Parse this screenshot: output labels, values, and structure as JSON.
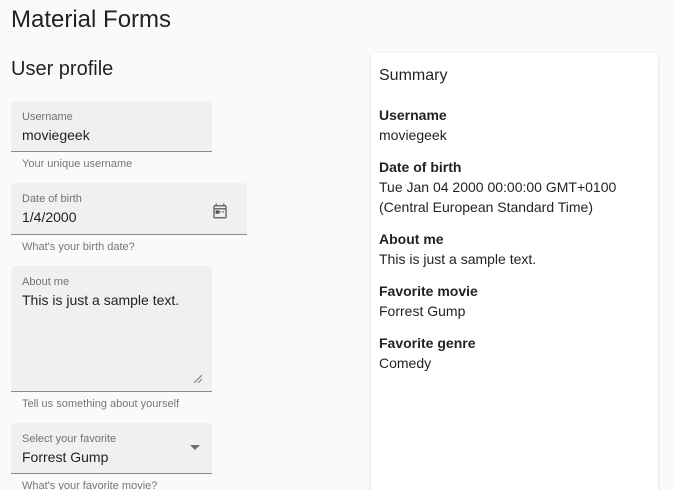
{
  "app": {
    "title": "Material Forms"
  },
  "form": {
    "title": "User profile",
    "username": {
      "label": "Username",
      "value": "moviegeek",
      "hint": "Your unique username"
    },
    "dob": {
      "label": "Date of birth",
      "value": "1/4/2000",
      "hint": "What's your birth date?",
      "icon": "calendar-icon"
    },
    "about": {
      "label": "About me",
      "value": "This is just a sample text.",
      "hint": "Tell us something about yourself"
    },
    "movie": {
      "label": "Select your favorite",
      "value": "Forrest Gump",
      "hint": "What's your favorite movie?",
      "icon": "chevron-down-icon"
    }
  },
  "summary": {
    "title": "Summary",
    "items": [
      {
        "key": "Username",
        "value": "moviegeek"
      },
      {
        "key": "Date of birth",
        "value": "Tue Jan 04 2000 00:00:00 GMT+0100 (Central European Standard Time)"
      },
      {
        "key": "About me",
        "value": "This is just a sample text."
      },
      {
        "key": "Favorite movie",
        "value": "Forrest Gump"
      },
      {
        "key": "Favorite genre",
        "value": "Comedy"
      }
    ]
  }
}
